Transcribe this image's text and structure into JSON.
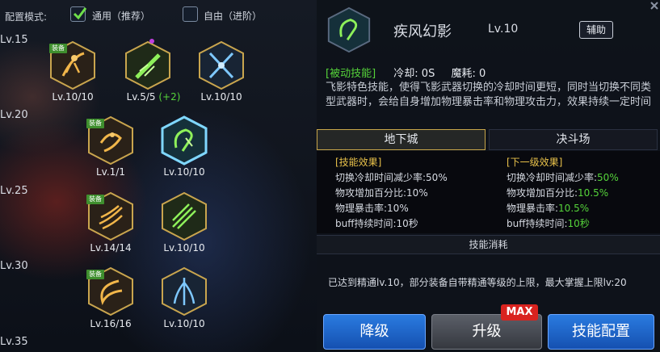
{
  "config": {
    "label": "配置模式:",
    "option_general": "通用（推荐）",
    "option_free": "自由（进阶）",
    "general_checked": true,
    "free_checked": false
  },
  "levels": [
    "Lv.15",
    "Lv.20",
    "Lv.25",
    "Lv.30",
    "Lv.35"
  ],
  "equip_badge": "装备",
  "skills": [
    {
      "lv": "Lv.10/10",
      "icon": "archer-leap-icon",
      "equipped": true
    },
    {
      "lv": "Lv.5/5",
      "bonus": "(+2)",
      "icon": "blade-dash-icon",
      "equipped": false
    },
    {
      "lv": "Lv.10/10",
      "icon": "crossed-blades-icon",
      "equipped": false
    },
    {
      "lv": "Lv.1/1",
      "icon": "spin-kick-icon",
      "equipped": true
    },
    {
      "lv": "Lv.10/10",
      "icon": "whirlwind-icon",
      "equipped": false
    },
    {
      "lv": "Lv.14/14",
      "icon": "slash-burst-icon",
      "equipped": true
    },
    {
      "lv": "Lv.10/10",
      "icon": "multi-slash-icon",
      "equipped": false
    },
    {
      "lv": "Lv.16/16",
      "icon": "crescent-strike-icon",
      "equipped": true
    },
    {
      "lv": "Lv.10/10",
      "icon": "wind-surge-icon",
      "equipped": false
    }
  ],
  "detail": {
    "name": "疾风幻影",
    "level": "Lv.10",
    "tag": "辅助",
    "passive": "[被动技能]",
    "cooldown": "冷却: 0S",
    "mana": "魔耗: 0",
    "description": "飞影特色技能，使得飞影武器切换的冷却时间更短，同时当切换不同类型武器时，会给自身增加物理暴击率和物理攻击力，效果持续一定时间",
    "tab_dungeon": "地下城",
    "tab_arena": "决斗场",
    "current_head": "[技能效果]",
    "current_lines": [
      "切换冷却时间减少率:50%",
      "物攻增加百分比:10%",
      "物理暴击率:10%",
      "buff持续时间:10秒"
    ],
    "next_head": "[下一级效果]",
    "next_lines": [
      {
        "label": "切换冷却时间减少率:",
        "value": "50%"
      },
      {
        "label": "物攻增加百分比:",
        "value": "10.5%"
      },
      {
        "label": "物理暴击率:",
        "value": "10.5%"
      },
      {
        "label": "buff持续时间:",
        "value": "10秒"
      }
    ],
    "consume": "技能消耗",
    "mastery": "已达到精通lv.10，部分装备自带精通等级的上限，最大掌握上限lv:20"
  },
  "buttons": {
    "downgrade": "降级",
    "upgrade": "升级",
    "max": "MAX",
    "config": "技能配置"
  },
  "colors": {
    "accent_green": "#55d33a",
    "accent_gold": "#e8c14a",
    "button_blue": "#2a7be0",
    "max_red": "#d9231f"
  }
}
